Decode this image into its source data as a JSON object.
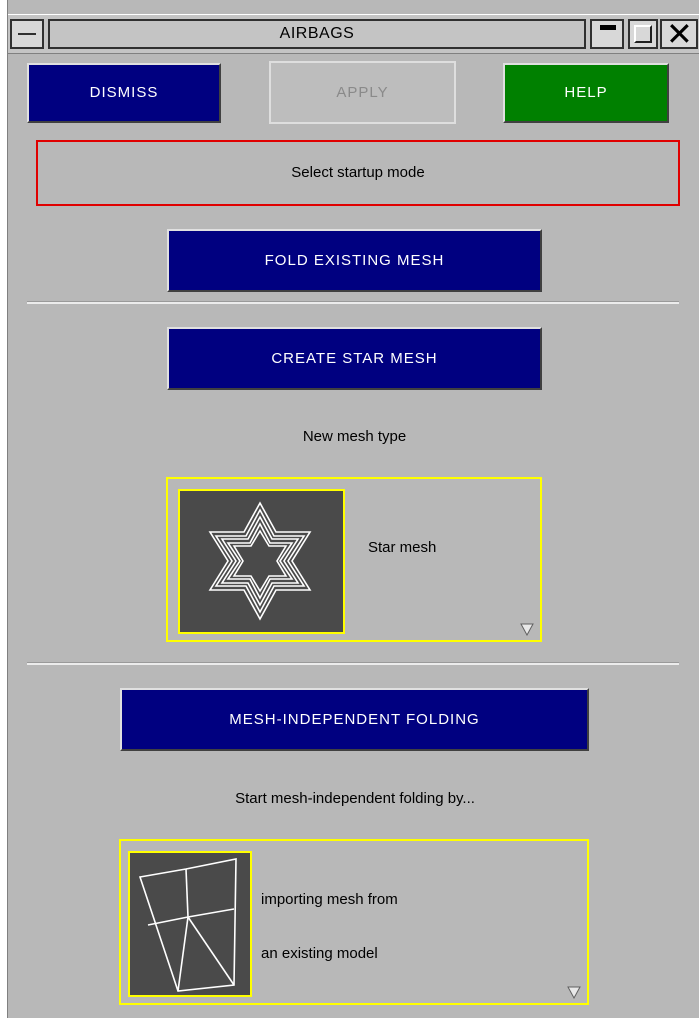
{
  "window": {
    "title": "AIRBAGS"
  },
  "toolbar": {
    "dismiss_label": "DISMISS",
    "apply_label": "APPLY",
    "help_label": "HELP"
  },
  "status": {
    "message": "Select startup mode"
  },
  "modes": {
    "fold_label": "FOLD EXISTING MESH",
    "create_star_label": "CREATE STAR MESH",
    "new_mesh_type_label": "New mesh type",
    "star_mesh_option": "Star mesh",
    "mesh_independent_label": "MESH-INDEPENDENT FOLDING",
    "start_mif_label": "Start mesh-independent folding by...",
    "import_option_line1": "importing mesh from",
    "import_option_line2": "an existing model"
  },
  "colors": {
    "panel_bg": "#b8b8b8",
    "navy_button": "#000080",
    "help_green": "#008000",
    "status_border": "#e00000",
    "selector_border": "#ffff00",
    "thumb_bg": "#4a4a4a"
  },
  "icons": {
    "window_menu": "window-menu-icon",
    "minimize": "minimize-icon",
    "maximize": "maximize-icon",
    "close": "close-icon",
    "star_mesh": "star-mesh-icon",
    "imported_mesh": "imported-mesh-icon",
    "dropdown": "dropdown-arrow-icon"
  }
}
